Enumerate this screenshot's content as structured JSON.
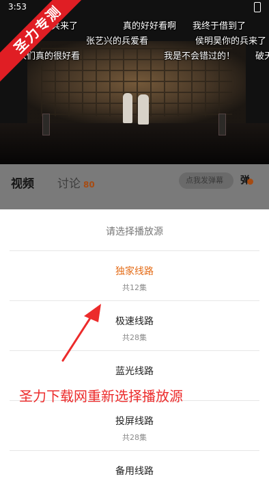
{
  "status_bar": {
    "time": "3:53"
  },
  "watermark": {
    "text": "圣力专测"
  },
  "danmaku": [
    "真的好好看啊",
    "我终于借到了",
    "的兵来了",
    "张艺兴的兵爱看",
    "侯明昊你的兵来了",
    "人们真的很好看",
    "我是不会错过的！",
    "破天"
  ],
  "tabs": {
    "video": "视频",
    "discussion": "讨论",
    "discussion_count": "80"
  },
  "danmaku_input": {
    "placeholder": "点我发弹幕"
  },
  "danmaku_toggle": {
    "label": "弹"
  },
  "source_sheet": {
    "title": "请选择播放源",
    "options": [
      {
        "name": "独家线路",
        "episodes": "共12集",
        "selected": true
      },
      {
        "name": "极速线路",
        "episodes": "共28集",
        "selected": false
      },
      {
        "name": "蓝光线路",
        "episodes": "",
        "selected": false
      },
      {
        "name": "投屏线路",
        "episodes": "共28集",
        "selected": false
      },
      {
        "name": "备用线路",
        "episodes": "",
        "selected": false
      }
    ]
  },
  "annotation": {
    "text": "圣力下载网重新选择播放源"
  },
  "colors": {
    "accent": "#e46b16",
    "annotation": "#ec2b2b",
    "ribbon": "#e01e24"
  }
}
